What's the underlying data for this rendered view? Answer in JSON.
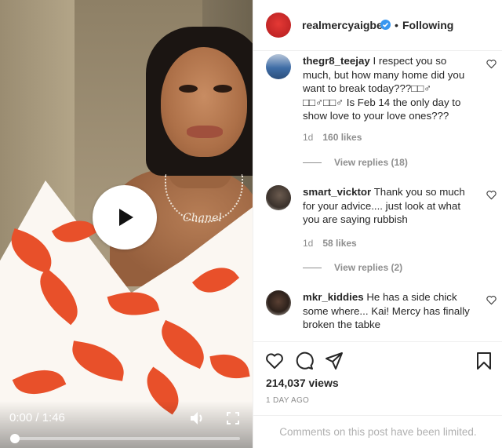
{
  "video": {
    "time": "0:00 / 1:46",
    "progress": 0.0,
    "pendant_text": "Chanel",
    "icons": [
      "play-icon",
      "volume-icon",
      "fullscreen-icon"
    ]
  },
  "header": {
    "username": "realmercyaigbe",
    "separator": "•",
    "follow_label": "Following"
  },
  "comments": [
    {
      "user": "thegr8_teejay",
      "text": "I respect you so much, but how many home did you want to break today???□□♂ □□♂□□♂ Is Feb 14 the only day to show love to your love ones???",
      "age": "1d",
      "likes": "160 likes",
      "replies": "View replies (18)"
    },
    {
      "user": "smart_vicktor",
      "text": "Thank you so much for your advice.... just look at what you are saying rubbish",
      "age": "1d",
      "likes": "58 likes",
      "replies": "View replies (2)"
    },
    {
      "user": "mkr_kiddies",
      "text": "He has a side chick some where... Kai! Mercy has finally broken the tabke"
    }
  ],
  "footer": {
    "views": "214,037 views",
    "date": "1 DAY AGO",
    "limited": "Comments on this post have been limited."
  },
  "colors": {
    "accent_blue": "#3897f0",
    "dress_red": "#e8502a",
    "text": "#262626",
    "muted": "#8e8e8e"
  }
}
